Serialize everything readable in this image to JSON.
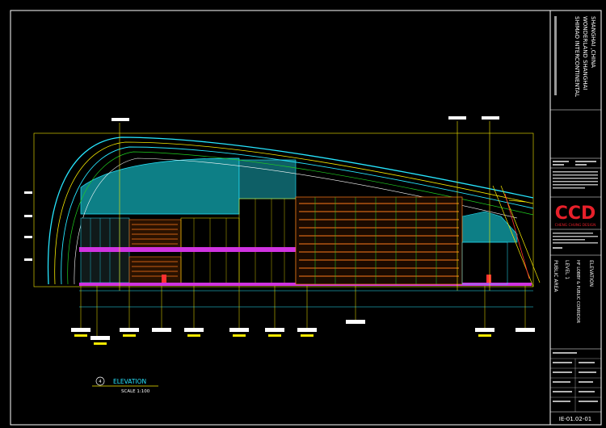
{
  "title_block": {
    "project_line1": "SHIMAO INTERCONTINENTAL",
    "project_line2": "WONDERLAND SHANGHAI",
    "project_line3": "SHANGHAI ,CHINA",
    "logo_text": "CCD",
    "logo_subtext": "CHENG CHUNG DESIGN",
    "area": "PUBLIC AREA",
    "level": "LEVEL 1",
    "room": "HF LOBBY & PUBLIC CORRIDOR",
    "sheet_title": "ELEVATION",
    "drawing_number": "IE-01.02-01"
  },
  "elevation_label": {
    "number": "4",
    "title": "ELEVATION",
    "scale": "SCALE 1:100"
  },
  "colors": {
    "frame": "#ffffff",
    "teal_fill": "#0d7f86",
    "cyan_line": "#27e6ff",
    "magenta_band": "#d033e0",
    "orange": "#ff7a1a",
    "red_logo": "#e8202a",
    "yellow": "#f5e800",
    "green": "#20d020"
  }
}
